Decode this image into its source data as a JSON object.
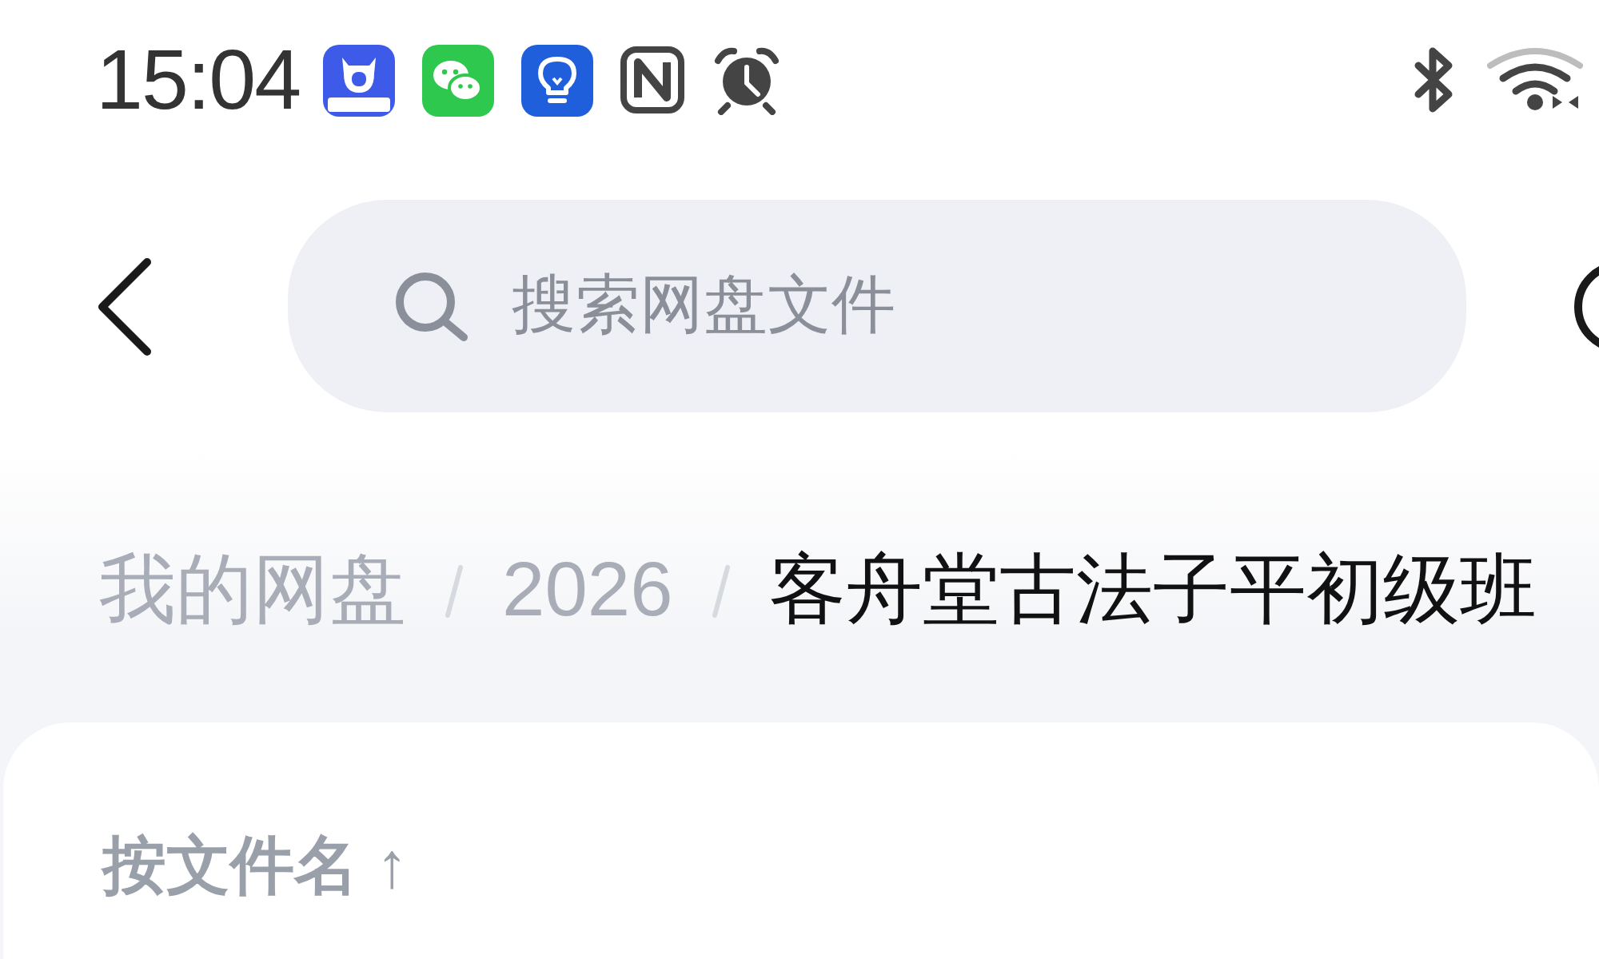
{
  "status_bar": {
    "time": "15:04"
  },
  "search": {
    "placeholder": "搜索网盘文件"
  },
  "breadcrumbs": [
    {
      "label": "我的网盘",
      "selected": false
    },
    {
      "label": "2026",
      "selected": false
    },
    {
      "label": "客舟堂古法子平初级班",
      "selected": true
    }
  ],
  "sort": {
    "label": "按文件名 ↑"
  }
}
